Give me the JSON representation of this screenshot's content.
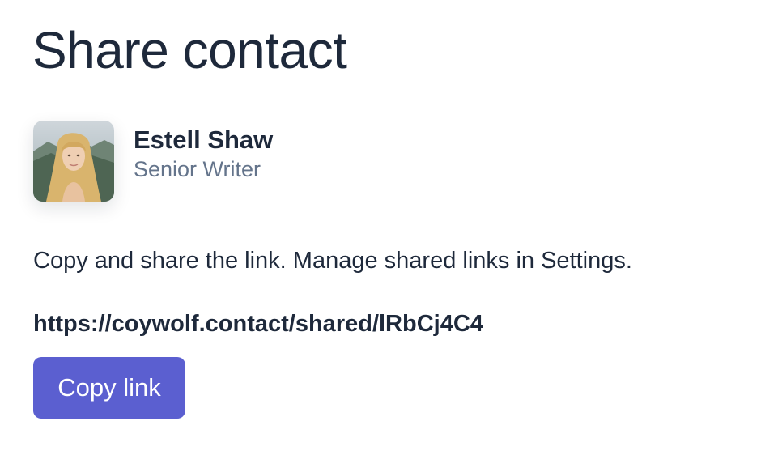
{
  "page": {
    "title": "Share contact"
  },
  "contact": {
    "name": "Estell Shaw",
    "role": "Senior Writer"
  },
  "share": {
    "instructions": "Copy and share the link. Manage shared links in Settings.",
    "url": "https://coywolf.contact/shared/lRbCj4C4",
    "copy_label": "Copy link"
  },
  "colors": {
    "button_background": "#5b5fd0",
    "text_primary": "#1e293b",
    "text_secondary": "#64748b"
  }
}
